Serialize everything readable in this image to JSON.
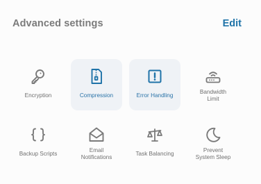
{
  "header": {
    "title": "Advanced settings",
    "edit_label": "Edit"
  },
  "colors": {
    "accent": "#1f73a8",
    "icon_default": "#7a7a7a",
    "selected_bg": "#eff2f6"
  },
  "items": [
    {
      "label": "Encryption",
      "icon": "key-icon",
      "selected": false
    },
    {
      "label": "Compression",
      "icon": "zip-file-icon",
      "selected": true
    },
    {
      "label": "Error Handling",
      "icon": "exclamation-box-icon",
      "selected": true
    },
    {
      "label": "Bandwidth\nLimit",
      "icon": "router-icon",
      "selected": false
    },
    {
      "label": "Backup Scripts",
      "icon": "curly-braces-icon",
      "selected": false
    },
    {
      "label": "Email\nNotifications",
      "icon": "open-envelope-icon",
      "selected": false
    },
    {
      "label": "Task Balancing",
      "icon": "scales-icon",
      "selected": false
    },
    {
      "label": "Prevent\nSystem Sleep",
      "icon": "moon-icon",
      "selected": false
    }
  ]
}
